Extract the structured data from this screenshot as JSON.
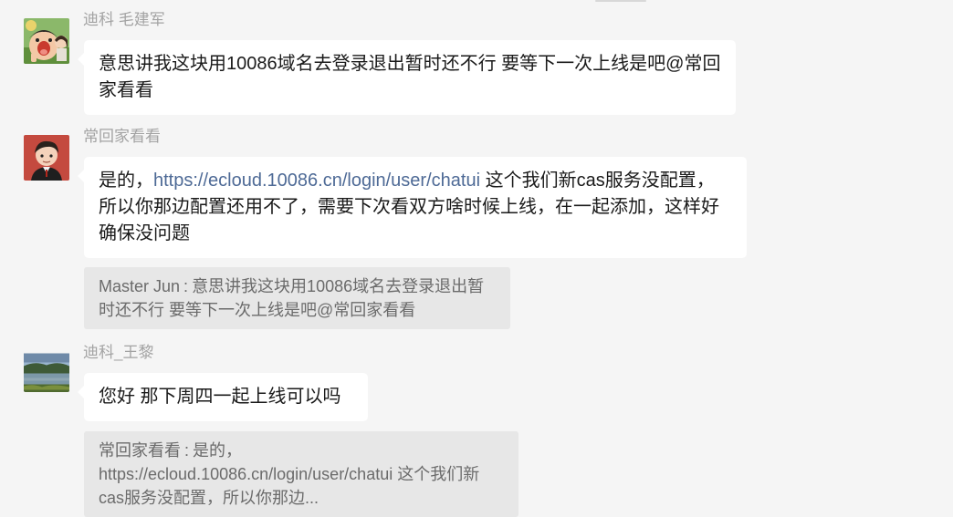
{
  "messages": [
    {
      "sender": "迪科  毛建军",
      "text": "意思讲我这块用10086域名去登录退出暂时还不行  要等下一次上线是吧@常回家看看"
    },
    {
      "sender": "常回家看看",
      "text_before_link": "是的，",
      "link": "https://ecloud.10086.cn/login/user/chatui",
      "text_after_link": "  这个我们新cas服务没配置，所以你那边配置还用不了，需要下次看双方啥时候上线，在一起添加，这样好确保没问题",
      "quote": {
        "author": "Master Jun",
        "separator": ":",
        "text": "意思讲我这块用10086域名去登录退出暂时还不行  要等下一次上线是吧@常回家看看"
      }
    },
    {
      "sender": "迪科_王黎",
      "text": "您好 那下周四一起上线可以吗",
      "quote": {
        "author": "常回家看看",
        "separator": ":",
        "text": "是的，https://ecloud.10086.cn/login/user/chatui  这个我们新cas服务没配置，所以你那边..."
      }
    }
  ],
  "colors": {
    "background": "#f5f5f5",
    "bubble": "#ffffff",
    "quote_bg": "#e7e7e7",
    "link": "#4e6a96",
    "sender_name": "#a3a3a3"
  },
  "icons": {
    "avatar_1": "cartoon-boy-avatar",
    "avatar_2": "cartoon-man-avatar",
    "avatar_3": "landscape-photo-avatar"
  }
}
